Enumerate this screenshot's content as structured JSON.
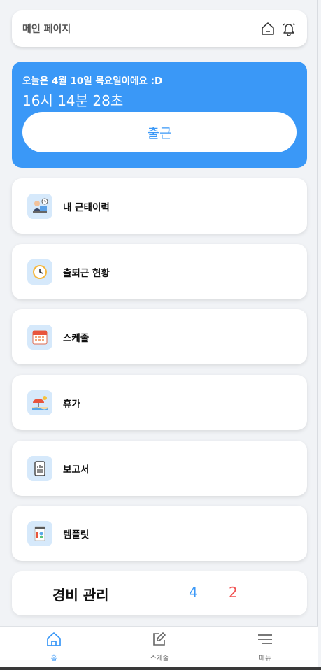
{
  "header": {
    "title": "메인 페이지",
    "icons": [
      "home-icon",
      "bell-icon"
    ]
  },
  "clock": {
    "date_text": "오늘은 4월 10일 목요일이에요 :D",
    "time_text": "16시 14분 28초",
    "checkin_label": "출근"
  },
  "menu": {
    "items": [
      {
        "label": "내 근태이력",
        "icon": "attendance-history-icon"
      },
      {
        "label": "출퇴근 현황",
        "icon": "clock-icon"
      },
      {
        "label": "스케줄",
        "icon": "calendar-icon"
      },
      {
        "label": "휴가",
        "icon": "beach-umbrella-icon"
      },
      {
        "label": "보고서",
        "icon": "report-document-icon"
      },
      {
        "label": "템플릿",
        "icon": "template-icon"
      }
    ]
  },
  "expense": {
    "title": "경비 관리",
    "count_blue": "4",
    "count_red": "2"
  },
  "tabbar": {
    "tabs": [
      {
        "label": "홈",
        "icon": "home-icon",
        "active": true
      },
      {
        "label": "스케줄",
        "icon": "edit-icon",
        "active": false
      },
      {
        "label": "메뉴",
        "icon": "menu-icon",
        "active": false
      }
    ]
  },
  "colors": {
    "accent": "#3a98f7",
    "danger": "#f05050",
    "background": "#f1f3f6"
  }
}
